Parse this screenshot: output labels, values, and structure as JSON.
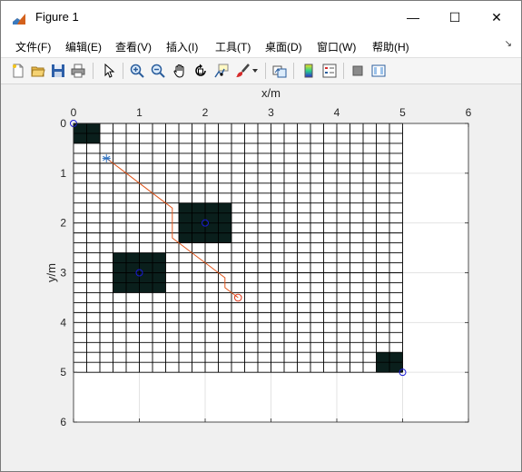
{
  "window": {
    "title": "Figure 1",
    "controls": {
      "minimize": "—",
      "maximize": "☐",
      "close": "✕"
    }
  },
  "menu": {
    "items": [
      "文件(F)",
      "编辑(E)",
      "查看(V)",
      "插入(I)",
      "工具(T)",
      "桌面(D)",
      "窗口(W)",
      "帮助(H)"
    ],
    "overflow_glyph": "↘"
  },
  "toolbar": {
    "icons": [
      "new-figure-icon",
      "open-file-icon",
      "save-icon",
      "print-icon",
      "pointer-icon",
      "zoom-in-icon",
      "zoom-out-icon",
      "pan-hand-icon",
      "rotate-3d-icon",
      "data-cursor-icon",
      "brush-icon",
      "brush-dropdown-icon",
      "link-plot-icon",
      "colorbar-icon",
      "legend-icon",
      "hide-plot-tools-icon",
      "show-plot-tools-icon"
    ]
  },
  "chart_data": {
    "type": "scatter",
    "xlabel": "x/m",
    "ylabel": "y/m",
    "xlim": [
      0,
      6
    ],
    "ylim": [
      0,
      6
    ],
    "y_reversed": true,
    "x_axis_location": "top",
    "xticks": [
      "0",
      "1",
      "2",
      "3",
      "4",
      "5",
      "6"
    ],
    "yticks": [
      "0",
      "1",
      "2",
      "3",
      "4",
      "5",
      "6"
    ],
    "grid": true,
    "map_grid": {
      "x_range": [
        0,
        5
      ],
      "y_range": [
        0,
        5
      ],
      "cell_size": 0.2
    },
    "obstacles": [
      {
        "x": [
          0,
          0.4
        ],
        "y": [
          0,
          0.4
        ]
      },
      {
        "x": [
          1.6,
          2.4
        ],
        "y": [
          1.6,
          2.4
        ]
      },
      {
        "x": [
          0.6,
          1.4
        ],
        "y": [
          2.6,
          3.4
        ]
      },
      {
        "x": [
          4.6,
          5.0
        ],
        "y": [
          4.6,
          5.0
        ]
      }
    ],
    "obstacle_color": "#0a1f1c",
    "centers": [
      {
        "x": 0,
        "y": 0
      },
      {
        "x": 2,
        "y": 2
      },
      {
        "x": 1,
        "y": 3
      },
      {
        "x": 5,
        "y": 5
      }
    ],
    "center_color": "#1a1ad6",
    "start": {
      "x": 0.5,
      "y": 0.7,
      "marker": "*",
      "color": "#2a6fbf"
    },
    "goal": {
      "x": 2.5,
      "y": 3.5,
      "marker": "o",
      "color": "#e0391c"
    },
    "path": {
      "color": "#e0561c",
      "x": [
        0.5,
        0.6,
        0.7,
        0.8,
        0.9,
        1.0,
        1.1,
        1.2,
        1.3,
        1.4,
        1.5,
        1.5,
        1.5,
        1.6,
        1.7,
        1.8,
        1.9,
        2.0,
        2.1,
        2.2,
        2.3,
        2.3,
        2.4,
        2.5
      ],
      "y": [
        0.7,
        0.8,
        0.9,
        1.0,
        1.1,
        1.2,
        1.3,
        1.4,
        1.5,
        1.6,
        1.7,
        2.0,
        2.3,
        2.4,
        2.5,
        2.6,
        2.7,
        2.8,
        2.9,
        3.0,
        3.1,
        3.3,
        3.4,
        3.5
      ]
    }
  }
}
